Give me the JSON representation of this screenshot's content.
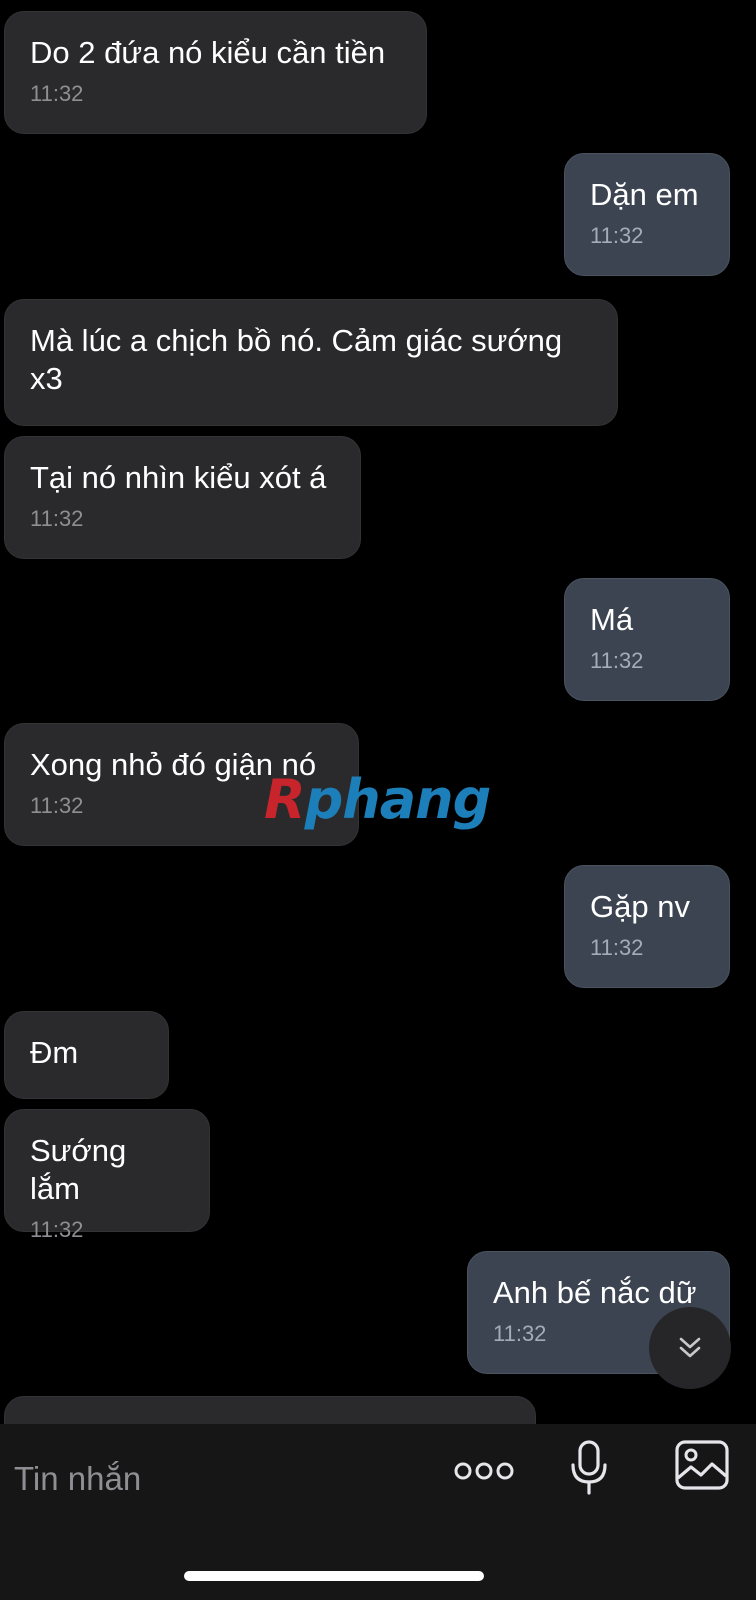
{
  "messages": [
    {
      "side": "in",
      "text": "Do 2 đứa nó kiểu cần tiền",
      "time": "11:32"
    },
    {
      "side": "out",
      "text": "Dặn em",
      "time": "11:32"
    },
    {
      "side": "in",
      "text": "Mà lúc a chịch bồ nó. Cảm giác sướng x3",
      "time": ""
    },
    {
      "side": "in",
      "text": "Tại nó nhìn kiểu xót á",
      "time": "11:32"
    },
    {
      "side": "out",
      "text": "Má",
      "time": "11:32"
    },
    {
      "side": "in",
      "text": "Xong nhỏ đó giận nó",
      "time": "11:32"
    },
    {
      "side": "out",
      "text": "Gặp nv",
      "time": "11:32"
    },
    {
      "side": "in",
      "text": "Đm",
      "time": ""
    },
    {
      "side": "in",
      "text": "Sướng lắm",
      "time": "11:32"
    },
    {
      "side": "out",
      "text": "Anh bế nắc dữ",
      "time": "11:32"
    }
  ],
  "watermark": {
    "first": "R",
    "rest": "phang"
  },
  "input": {
    "placeholder": "Tin nhắn"
  },
  "icons": {
    "scroll": "double-chevron-down-icon",
    "more": "more-dots-icon",
    "mic": "microphone-icon",
    "gallery": "image-gallery-icon"
  },
  "colors": {
    "incoming_bubble": "#2a2a2c",
    "outgoing_bubble": "#3b4450",
    "background": "#000000"
  }
}
